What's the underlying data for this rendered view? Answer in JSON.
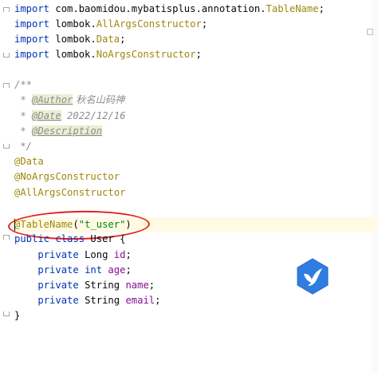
{
  "editor": {
    "imports": [
      {
        "kw": "import",
        "path_prefix": " com.baomidou.mybatisplus.annotation.",
        "cls": "TableName",
        "end": ";"
      },
      {
        "kw": "import",
        "path_prefix": " lombok.",
        "cls": "AllArgsConstructor",
        "end": ";"
      },
      {
        "kw": "import",
        "path_prefix": " lombok.",
        "cls": "Data",
        "end": ";"
      },
      {
        "kw": "import",
        "path_prefix": " lombok.",
        "cls": "NoArgsConstructor",
        "end": ";"
      }
    ],
    "javadoc": {
      "open": "/**",
      "star": " * ",
      "author_tag": "@Author",
      "author_value": " 秋名山码神",
      "date_tag": "@Date",
      "date_value": " 2022/12/16",
      "desc_tag": "@Description",
      "close": " */"
    },
    "annotations": [
      "@Data",
      "@NoArgsConstructor",
      "@AllArgsConstructor"
    ],
    "table_annotation": {
      "name": "@TableName",
      "open": "(",
      "value": "\"t_user\"",
      "close": ")"
    },
    "class_decl": {
      "kw1": "public",
      "kw2": " class",
      "rest": " User {"
    },
    "fields": [
      {
        "kw": "private",
        "type": " Long ",
        "name": "id",
        "end": ";"
      },
      {
        "kw": "private",
        "type": " int ",
        "name": "age",
        "end": ";"
      },
      {
        "kw": "private",
        "type": " String ",
        "name": "name",
        "end": ";"
      },
      {
        "kw": "private",
        "type": " String ",
        "name": "email",
        "end": ";"
      }
    ],
    "class_close": "}",
    "indent": "    "
  },
  "colors": {
    "keyword": "#0033b3",
    "annotation": "#9e880d",
    "string": "#067d17",
    "field": "#871094",
    "comment": "#8c8c8c",
    "highlight_ring": "#e52020",
    "logo": "#2f7de1"
  },
  "overlay": {
    "logo_icon": "bird-logo-icon"
  }
}
